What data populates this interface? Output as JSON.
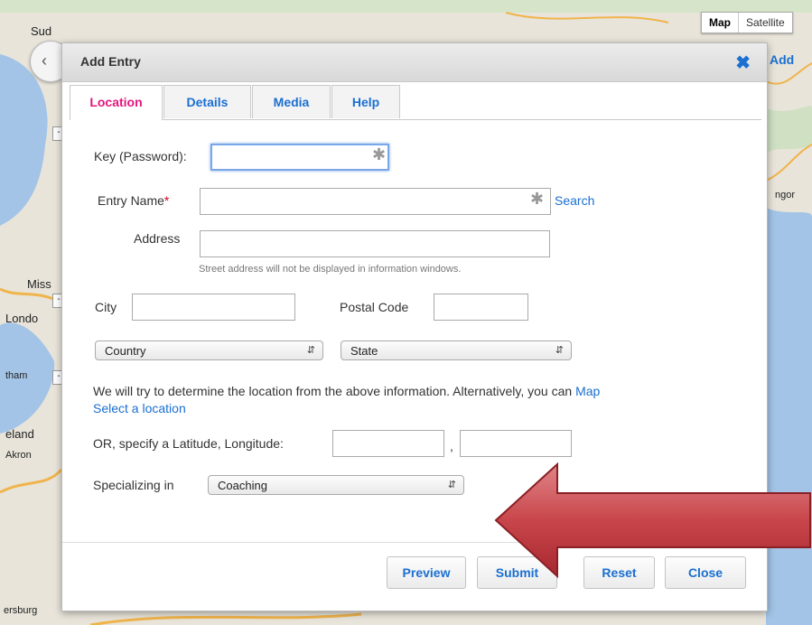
{
  "map": {
    "labels": [
      "Sud",
      "Miss",
      "Londo",
      "tham",
      "eland",
      "Akron",
      "ersburg",
      "ngor"
    ],
    "map_type": {
      "map_label": "Map",
      "satellite_label": "Satellite"
    },
    "add_link": "Add",
    "nav_icon": "pan-arrows-icon"
  },
  "dialog": {
    "title": "Add Entry",
    "close_icon": "close-icon",
    "tabs": [
      "Location",
      "Details",
      "Media",
      "Help"
    ],
    "active_tab": "Location",
    "fields": {
      "key_label": "Key (Password):",
      "key_value": "",
      "entry_name_label": "Entry Name",
      "entry_name_required": "*",
      "entry_name_value": "",
      "search_link": "Search",
      "address_label": "Address",
      "address_value": "",
      "address_hint": "Street address will not be displayed in information windows.",
      "city_label": "City",
      "city_value": "",
      "postal_label": "Postal Code",
      "postal_value": "",
      "country_select": "Country",
      "state_select": "State",
      "locate_text": "We will try to determine the location from the above information. Alternatively, you can",
      "locate_link_1": "Map",
      "locate_link_2": "Select a location",
      "latlng_label": "OR, specify a Latitude, Longitude:",
      "latlng_separator": ",",
      "latitude_value": "",
      "longitude_value": "",
      "specializing_label": "Specializing in",
      "specializing_select": "Coaching"
    },
    "buttons": {
      "preview": "Preview",
      "submit": "Submit",
      "reset": "Reset",
      "close": "Close"
    }
  },
  "overlay": {
    "arrow_color": "#c8464b"
  },
  "colors": {
    "link": "#1a6fd1",
    "active_tab": "#e4167c",
    "required": "#d0021b"
  }
}
